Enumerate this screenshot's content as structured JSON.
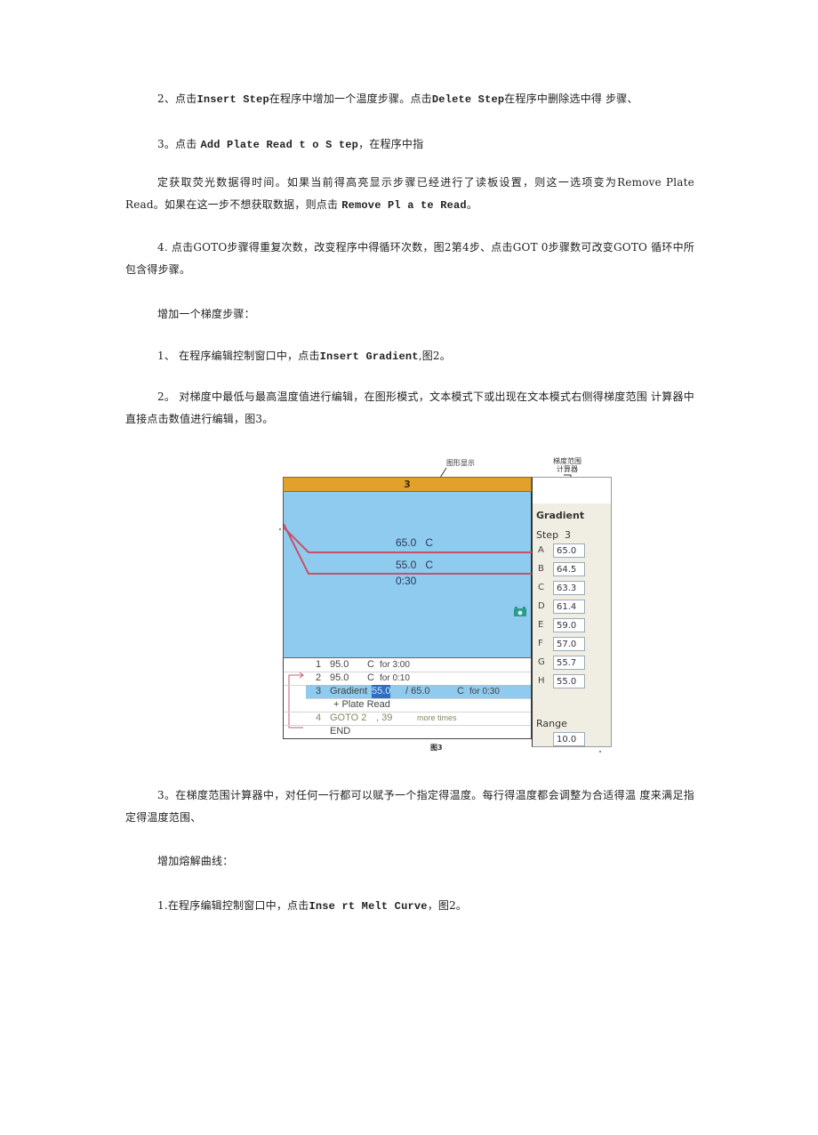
{
  "paragraphs": {
    "p1": {
      "prefix": "2、点击",
      "cmd1": "Insert Step",
      "mid": "在程序中增加一个温度步骤。点击",
      "cmd2": "Delete Step",
      "suffix": "在程序中删除选中得 步骤、"
    },
    "p2": {
      "prefix": "3。点击 ",
      "cmd": "Add Plate Read t o S tep",
      "suffix": "，在程序中指"
    },
    "p3": {
      "text1": "定获取荧光数据得时间。如果当前得高亮显示步骤已经进行了读板设置，则这一选项变为Remove   Plate Read。如果在这一步不想获取数据，则点击 ",
      "cmd": "Remove Pl a te Read",
      "suffix": "。"
    },
    "p4": {
      "text": "4. 点击GOTO步骤得重复次数，改变程序中得循环次数，图2第4步、点击GOT  0步骤数可改变GOTO  循环中所包含得步骤。"
    },
    "heading1": "增加一个梯度步骤：",
    "p5": {
      "prefix": "1、 在程序编辑控制窗口中，点击",
      "cmd": "Insert Gradient",
      "suffix": ",图2。"
    },
    "p6": {
      "text": "2。 对梯度中最低与最高温度值进行编辑，在图形模式，文本模式下或出现在文本模式右侧得梯度范围 计算器中直接点击数值进行编辑，图3。"
    },
    "p7": {
      "text": "3。在梯度范围计算器中，对任何一行都可以赋予一个指定得温度。每行得温度都会调整为合适得温 度来满足指定得温度范围、"
    },
    "heading2": "增加熔解曲线：",
    "p8": {
      "prefix": "1.在程序编辑控制窗口中，点击",
      "cmd": "Inse rt Melt Curve",
      "suffix": "，图2。"
    }
  },
  "figure": {
    "callout_graph": "图形显示",
    "callout_calc_line1": "梯度范围",
    "callout_calc_line2": "计算器",
    "header_step": "3",
    "graph": {
      "upper_temp": "65.0",
      "lower_temp": "55.0",
      "unit": "C",
      "hold_time": "0:30",
      "plate_read_icon": "camera-icon"
    },
    "steps": [
      {
        "num": "1",
        "text": "95.0",
        "unit": "C",
        "tail": "for 3:00"
      },
      {
        "num": "2",
        "text": "95.0",
        "unit": "C",
        "tail": "for 0:10"
      },
      {
        "num": "3",
        "label": "Gradient",
        "low": "55.0",
        "high": "/ 65.0",
        "unit": "C",
        "tail": "for 0:30"
      },
      {
        "sub": "+ Plate Read"
      },
      {
        "num": "4",
        "label": "GOTO 2",
        "count": ", 39",
        "tail": "more times"
      },
      {
        "end": "END"
      }
    ],
    "gradient_panel": {
      "title": "Gradient",
      "step_label": "Step",
      "step_value": "3",
      "rows": [
        {
          "letter": "A",
          "value": "65.0"
        },
        {
          "letter": "B",
          "value": "64.5"
        },
        {
          "letter": "C",
          "value": "63.3"
        },
        {
          "letter": "D",
          "value": "61.4"
        },
        {
          "letter": "E",
          "value": "59.0"
        },
        {
          "letter": "F",
          "value": "57.0"
        },
        {
          "letter": "G",
          "value": "55.7"
        },
        {
          "letter": "H",
          "value": "55.0"
        }
      ],
      "range_label": "Range",
      "range_value": "10.0"
    },
    "caption": "图3",
    "colors": {
      "header": "#e2a12a",
      "graph_bg": "#8ecbee",
      "curve": "#c8506a",
      "panel_bg": "#f0eee2"
    }
  }
}
